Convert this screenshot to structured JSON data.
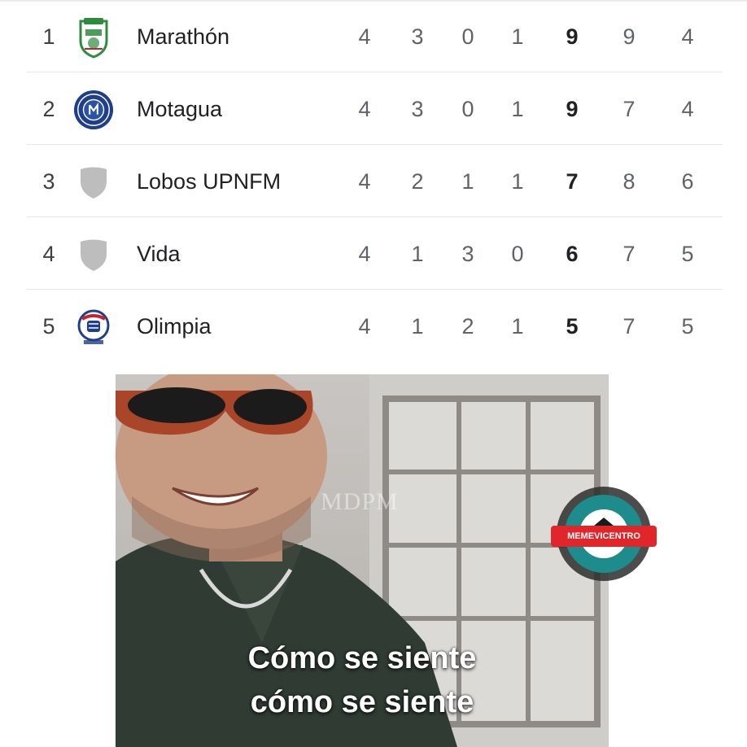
{
  "standings": {
    "rows": [
      {
        "pos": "1",
        "team": "Marathón",
        "crest": "marathon-crest-icon",
        "stats": [
          "4",
          "3",
          "0",
          "1",
          "9",
          "9",
          "4"
        ]
      },
      {
        "pos": "2",
        "team": "Motagua",
        "crest": "motagua-crest-icon",
        "stats": [
          "4",
          "3",
          "0",
          "1",
          "9",
          "7",
          "4"
        ]
      },
      {
        "pos": "3",
        "team": "Lobos UPNFM",
        "crest": "shield-placeholder-icon",
        "stats": [
          "4",
          "2",
          "1",
          "1",
          "7",
          "8",
          "6"
        ]
      },
      {
        "pos": "4",
        "team": "Vida",
        "crest": "shield-placeholder-icon",
        "stats": [
          "4",
          "1",
          "3",
          "0",
          "6",
          "7",
          "5"
        ]
      },
      {
        "pos": "5",
        "team": "Olimpia",
        "crest": "olimpia-crest-icon",
        "stats": [
          "4",
          "1",
          "2",
          "1",
          "5",
          "7",
          "5"
        ]
      }
    ]
  },
  "meme": {
    "caption_line1": "Cómo se siente",
    "caption_line2": "cómo se siente",
    "watermark": "MDPM",
    "logo_text": "MEMEVICENTRO"
  },
  "colors": {
    "motagua_blue": "#1f3f8a",
    "marathon_green": "#2e8b3e",
    "olimpia_red": "#c8202c",
    "placeholder_gray": "#bdbdbd",
    "logo_red": "#e0262b"
  }
}
